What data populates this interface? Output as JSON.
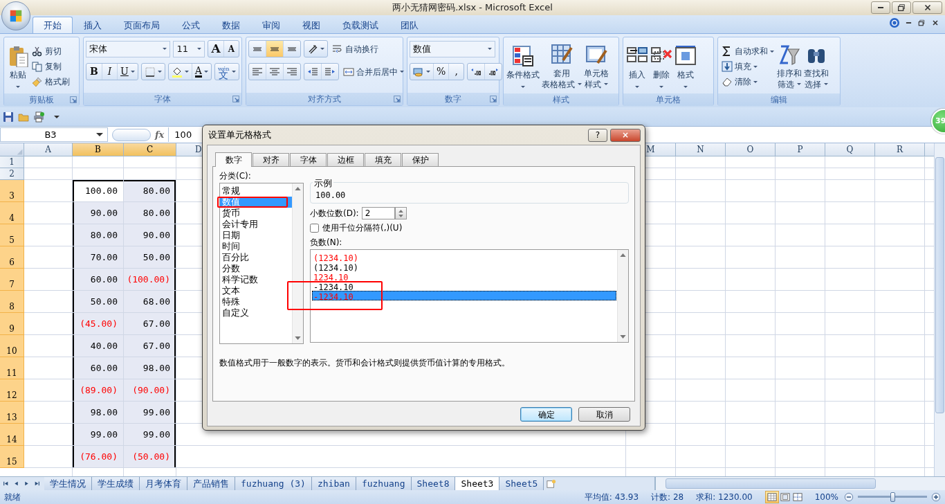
{
  "window": {
    "title": "两小无猜网密码.xlsx - Microsoft Excel"
  },
  "ribbon": {
    "tabs": [
      {
        "label": "开始",
        "selected": true
      },
      {
        "label": "插入",
        "selected": false
      },
      {
        "label": "页面布局",
        "selected": false
      },
      {
        "label": "公式",
        "selected": false
      },
      {
        "label": "数据",
        "selected": false
      },
      {
        "label": "审阅",
        "selected": false
      },
      {
        "label": "视图",
        "selected": false
      },
      {
        "label": "负载测试",
        "selected": false
      },
      {
        "label": "团队",
        "selected": false
      }
    ],
    "groups": [
      {
        "label": "剪贴板",
        "launcher": true,
        "rows": [
          {
            "controls": [
              {
                "kind": "large",
                "lines": [
                  "粘贴"
                ],
                "caret": true
              },
              {
                "kind": "stack",
                "items": [
                  {
                    "label": "剪切",
                    "caret": false
                  },
                  {
                    "label": "复制",
                    "caret": false
                  },
                  {
                    "label": "格式刷",
                    "caret": false
                  }
                ]
              }
            ]
          }
        ]
      },
      {
        "label": "字体",
        "launcher": true,
        "rows": [
          {
            "controls": [
              {
                "kind": "combo",
                "value": "宋体"
              },
              {
                "kind": "combo",
                "value": "11"
              },
              {
                "kind": "seg",
                "buttons": [
                  {
                    "text": "A",
                    "caret": false
                  },
                  {
                    "text": "A",
                    "caret": false
                  }
                ]
              }
            ]
          },
          {
            "controls": [
              {
                "kind": "seg",
                "buttons": [
                  {
                    "text": "B",
                    "caret": false
                  },
                  {
                    "text": "I",
                    "caret": false
                  },
                  {
                    "text": "U",
                    "caret": true
                  }
                ]
              },
              {
                "kind": "seg",
                "buttons": [
                  {
                    "caret": true
                  }
                ]
              },
              {
                "kind": "seg",
                "buttons": [
                  {
                    "caret": true
                  },
                  {
                    "text": "A",
                    "caret": true
                  }
                ]
              },
              {
                "kind": "seg",
                "buttons": [
                  {
                    "text": "文",
                    "ruby": "wén",
                    "caret": true
                  }
                ]
              }
            ]
          }
        ]
      },
      {
        "label": "对齐方式",
        "launcher": true,
        "rows": [
          {
            "controls": [
              {
                "kind": "seg",
                "buttons": [
                  {
                    "caret": false,
                    "selected": false
                  },
                  {
                    "caret": false,
                    "selected": true
                  },
                  {
                    "caret": false,
                    "selected": false
                  }
                ]
              },
              {
                "kind": "seg",
                "buttons": [
                  {
                    "caret": true
                  }
                ]
              },
              {
                "kind": "small",
                "label": "自动换行",
                "caret": false
              }
            ]
          },
          {
            "controls": [
              {
                "kind": "seg",
                "buttons": [
                  {
                    "caret": false,
                    "selected": false
                  },
                  {
                    "caret": false,
                    "selected": false
                  },
                  {
                    "caret": false,
                    "selected": false
                  }
                ]
              },
              {
                "kind": "seg",
                "buttons": [
                  {
                    "caret": false
                  },
                  {
                    "caret": false
                  }
                ]
              },
              {
                "kind": "small",
                "label": "合并后居中",
                "caret": true
              }
            ]
          }
        ]
      },
      {
        "label": "数字",
        "launcher": true,
        "rows": [
          {
            "controls": [
              {
                "kind": "combo",
                "value": "数值"
              }
            ]
          },
          {
            "controls": [
              {
                "kind": "seg",
                "buttons": [
                  {
                    "caret": true
                  },
                  {
                    "text": "%",
                    "caret": false
                  },
                  {
                    "text": ",",
                    "caret": false
                  }
                ]
              },
              {
                "kind": "seg",
                "buttons": [
                  {
                    "caret": false
                  },
                  {
                    "caret": false
                  }
                ]
              }
            ]
          }
        ]
      },
      {
        "label": "样式",
        "launcher": false,
        "rows": [
          {
            "controls": [
              {
                "kind": "large",
                "lines": [
                  "条件格式"
                ],
                "caret": true
              },
              {
                "kind": "large",
                "lines": [
                  "套用",
                  "表格格式"
                ],
                "caret": true
              },
              {
                "kind": "large",
                "lines": [
                  "单元格",
                  "样式"
                ],
                "caret": true
              }
            ]
          }
        ]
      },
      {
        "label": "单元格",
        "launcher": false,
        "rows": [
          {
            "controls": [
              {
                "kind": "large",
                "lines": [
                  "插入"
                ],
                "caret": true
              },
              {
                "kind": "large",
                "lines": [
                  "删除"
                ],
                "caret": true
              },
              {
                "kind": "large",
                "lines": [
                  "格式"
                ],
                "caret": true
              }
            ]
          }
        ]
      },
      {
        "label": "编辑",
        "launcher": false,
        "rows": [
          {
            "controls": [
              {
                "kind": "stack",
                "items": [
                  {
                    "label": "自动求和",
                    "caret": true
                  },
                  {
                    "label": "填充",
                    "caret": true
                  },
                  {
                    "label": "清除",
                    "caret": true
                  }
                ]
              },
              {
                "kind": "large",
                "lines": [
                  "排序和",
                  "筛选"
                ],
                "caret": true
              },
              {
                "kind": "large",
                "lines": [
                  "查找和",
                  "选择"
                ],
                "caret": true
              }
            ]
          }
        ]
      }
    ]
  },
  "formula_bar": {
    "name_box": "B3",
    "function_label": "fx",
    "value": "100"
  },
  "badge": "39",
  "sheet": {
    "columns": [
      {
        "label": "A",
        "selected": false
      },
      {
        "label": "B",
        "selected": true
      },
      {
        "label": "C",
        "selected": true
      },
      {
        "label": "D",
        "selected": false
      },
      {
        "label": "M",
        "selected": false
      },
      {
        "label": "N",
        "selected": false
      },
      {
        "label": "O",
        "selected": false
      },
      {
        "label": "P",
        "selected": false
      },
      {
        "label": "Q",
        "selected": false
      },
      {
        "label": "R",
        "selected": false
      }
    ],
    "rows": [
      {
        "label": "1",
        "selected": false,
        "cells": []
      },
      {
        "label": "2",
        "selected": false,
        "cells": []
      },
      {
        "label": "3",
        "selected": true,
        "cells": [
          "",
          {
            "text": "100.00",
            "negative": false,
            "active": true
          },
          {
            "text": "80.00",
            "negative": false,
            "active": false
          }
        ]
      },
      {
        "label": "4",
        "selected": true,
        "cells": [
          "",
          {
            "text": "90.00",
            "negative": false,
            "active": false
          },
          {
            "text": "80.00",
            "negative": false,
            "active": false
          }
        ]
      },
      {
        "label": "5",
        "selected": true,
        "cells": [
          "",
          {
            "text": "80.00",
            "negative": false,
            "active": false
          },
          {
            "text": "90.00",
            "negative": false,
            "active": false
          }
        ]
      },
      {
        "label": "6",
        "selected": true,
        "cells": [
          "",
          {
            "text": "70.00",
            "negative": false,
            "active": false
          },
          {
            "text": "50.00",
            "negative": false,
            "active": false
          }
        ]
      },
      {
        "label": "7",
        "selected": true,
        "cells": [
          "",
          {
            "text": "60.00",
            "negative": false,
            "active": false
          },
          {
            "text": "(100.00)",
            "negative": true,
            "active": false
          }
        ]
      },
      {
        "label": "8",
        "selected": true,
        "cells": [
          "",
          {
            "text": "50.00",
            "negative": false,
            "active": false
          },
          {
            "text": "68.00",
            "negative": false,
            "active": false
          }
        ]
      },
      {
        "label": "9",
        "selected": true,
        "cells": [
          "",
          {
            "text": "(45.00)",
            "negative": true,
            "active": false
          },
          {
            "text": "67.00",
            "negative": false,
            "active": false
          }
        ]
      },
      {
        "label": "10",
        "selected": true,
        "cells": [
          "",
          {
            "text": "40.00",
            "negative": false,
            "active": false
          },
          {
            "text": "67.00",
            "negative": false,
            "active": false
          }
        ]
      },
      {
        "label": "11",
        "selected": true,
        "cells": [
          "",
          {
            "text": "60.00",
            "negative": false,
            "active": false
          },
          {
            "text": "98.00",
            "negative": false,
            "active": false
          }
        ]
      },
      {
        "label": "12",
        "selected": true,
        "cells": [
          "",
          {
            "text": "(89.00)",
            "negative": true,
            "active": false
          },
          {
            "text": "(90.00)",
            "negative": true,
            "active": false
          }
        ]
      },
      {
        "label": "13",
        "selected": true,
        "cells": [
          "",
          {
            "text": "98.00",
            "negative": false,
            "active": false
          },
          {
            "text": "99.00",
            "negative": false,
            "active": false
          }
        ]
      },
      {
        "label": "14",
        "selected": true,
        "cells": [
          "",
          {
            "text": "99.00",
            "negative": false,
            "active": false
          },
          {
            "text": "99.00",
            "negative": false,
            "active": false
          }
        ]
      },
      {
        "label": "15",
        "selected": true,
        "cells": [
          "",
          {
            "text": "(76.00)",
            "negative": true,
            "active": false
          },
          {
            "text": "(50.00)",
            "negative": true,
            "active": false
          }
        ]
      }
    ]
  },
  "dialog": {
    "title": "设置单元格格式",
    "help": "?",
    "close": "×",
    "tabs": [
      {
        "label": "数字",
        "selected": true
      },
      {
        "label": "对齐",
        "selected": false
      },
      {
        "label": "字体",
        "selected": false
      },
      {
        "label": "边框",
        "selected": false
      },
      {
        "label": "填充",
        "selected": false
      },
      {
        "label": "保护",
        "selected": false
      }
    ],
    "category_label": "分类(C):",
    "categories": [
      {
        "label": "常规",
        "selected": false,
        "highlighted": false
      },
      {
        "label": "数值",
        "selected": true,
        "highlighted": true
      },
      {
        "label": "货币",
        "selected": false,
        "highlighted": false
      },
      {
        "label": "会计专用",
        "selected": false,
        "highlighted": false
      },
      {
        "label": "日期",
        "selected": false,
        "highlighted": false
      },
      {
        "label": "时间",
        "selected": false,
        "highlighted": false
      },
      {
        "label": "百分比",
        "selected": false,
        "highlighted": false
      },
      {
        "label": "分数",
        "selected": false,
        "highlighted": false
      },
      {
        "label": "科学记数",
        "selected": false,
        "highlighted": false
      },
      {
        "label": "文本",
        "selected": false,
        "highlighted": false
      },
      {
        "label": "特殊",
        "selected": false,
        "highlighted": false
      },
      {
        "label": "自定义",
        "selected": false,
        "highlighted": false
      }
    ],
    "sample_label": "示例",
    "sample": "100.00",
    "decimals_label": "小数位数(D):",
    "decimals": "2",
    "separator": {
      "label": "使用千位分隔符(,)(U)",
      "checked": false
    },
    "negative_label": "负数(N):",
    "negatives": [
      {
        "text": "(1234.10)",
        "color": "#ff0000",
        "selected": false,
        "highlighted": false
      },
      {
        "text": "(1234.10)",
        "color": "#000000",
        "selected": false,
        "highlighted": false
      },
      {
        "text": "1234.10",
        "color": "#ff0000",
        "selected": false,
        "highlighted": false
      },
      {
        "text": "-1234.10",
        "color": "#000000",
        "selected": false,
        "highlighted": true
      },
      {
        "text": "-1234.10",
        "color": "#ff0000",
        "selected": true,
        "highlighted": true
      }
    ],
    "description": "数值格式用于一般数字的表示。货币和会计格式则提供货币值计算的专用格式。",
    "buttons": [
      {
        "label": "确定",
        "default": true
      },
      {
        "label": "取消",
        "default": false
      }
    ]
  },
  "sheet_tabs": [
    {
      "label": "学生情况",
      "selected": false
    },
    {
      "label": "学生成绩",
      "selected": false
    },
    {
      "label": "月考体育",
      "selected": false
    },
    {
      "label": "产品销售",
      "selected": false
    },
    {
      "label": "fuzhuang (3)",
      "selected": false
    },
    {
      "label": "zhiban",
      "selected": false
    },
    {
      "label": "fuzhuang",
      "selected": false
    },
    {
      "label": "Sheet8",
      "selected": false
    },
    {
      "label": "Sheet3",
      "selected": true
    },
    {
      "label": "Sheet5",
      "selected": false
    }
  ],
  "status_bar": {
    "mode": "就绪",
    "average": "平均值: 43.93",
    "count": "计数: 28",
    "sum": "求和: 1230.00",
    "views": [
      {
        "selected": true
      },
      {
        "selected": false
      },
      {
        "selected": false
      }
    ],
    "zoom": {
      "label": "100%",
      "level": 0.5
    }
  }
}
